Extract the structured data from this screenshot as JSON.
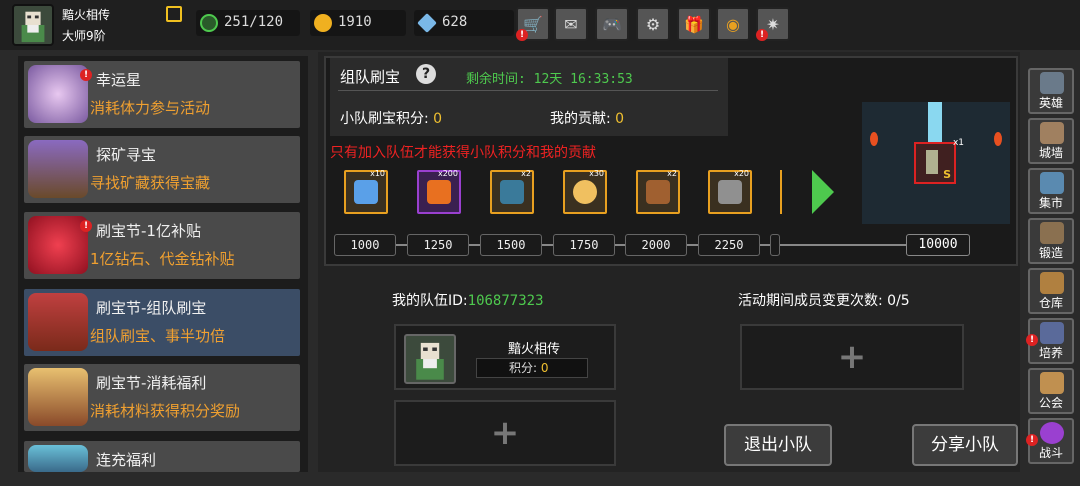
{
  "player": {
    "name": "黯火相传",
    "rank": "大师9阶"
  },
  "resources": [
    {
      "icon": "energy-icon",
      "value": "251/120",
      "color": "#4ec94e"
    },
    {
      "icon": "gold-coin-icon",
      "value": "1910",
      "color": "#f0b020"
    },
    {
      "icon": "diamond-icon",
      "value": "628",
      "color": "#7ab8e8"
    }
  ],
  "toolbar": [
    {
      "icon": "shop-cart-icon",
      "glyph": "🛒",
      "alert": true
    },
    {
      "icon": "mail-icon",
      "glyph": "✉",
      "alert": false
    },
    {
      "icon": "gamepad-icon",
      "glyph": "🎮",
      "alert": false
    },
    {
      "icon": "gear-icon",
      "glyph": "⚙",
      "alert": false
    },
    {
      "icon": "gift-icon",
      "glyph": "🎁",
      "alert": false
    },
    {
      "icon": "color-wheel-icon",
      "glyph": "◉",
      "alert": false
    },
    {
      "icon": "fireworks-icon",
      "glyph": "✷",
      "alert": true
    }
  ],
  "events": [
    {
      "title": "幸运星",
      "subtitle": "消耗体力参与活动",
      "icon": "lucky-star-icon",
      "alert": true,
      "selected": false
    },
    {
      "title": "探矿寻宝",
      "subtitle": "寻找矿藏获得宝藏",
      "icon": "mining-cart-icon",
      "alert": false,
      "selected": false
    },
    {
      "title": "刷宝节-1亿补贴",
      "subtitle": "1亿钻石、代金钻补贴",
      "icon": "red-flower-icon",
      "alert": true,
      "selected": false
    },
    {
      "title": "刷宝节-组队刷宝",
      "subtitle": "组队刷宝、事半功倍",
      "icon": "treasure-chest-icon",
      "alert": false,
      "selected": true
    },
    {
      "title": "刷宝节-消耗福利",
      "subtitle": "消耗材料获得积分奖励",
      "icon": "open-chest-icon",
      "alert": false,
      "selected": false
    },
    {
      "title": "连充福利",
      "subtitle": "",
      "icon": "crystal-icon",
      "alert": false,
      "selected": false
    }
  ],
  "panel": {
    "title": "组队刷宝",
    "timer_label": "剩余时间:",
    "timer_value": "12天 16:33:53",
    "team_score_label": "小队刷宝积分:",
    "team_score": "0",
    "contrib_label": "我的贡献:",
    "contrib": "0",
    "warning": "只有加入队伍才能获得小队积分和我的贡献"
  },
  "rewards": [
    {
      "icon": "lightning-icon",
      "count": "x10",
      "color": "#5aa0e8",
      "purple": false
    },
    {
      "icon": "flame-orb-icon",
      "count": "x200",
      "color": "#e87020",
      "purple": true
    },
    {
      "icon": "book-icon",
      "count": "x2",
      "color": "#3a7a9a",
      "purple": false
    },
    {
      "icon": "egg-icon",
      "count": "x30",
      "color": "#f0c060",
      "purple": false
    },
    {
      "icon": "scroll-icon",
      "count": "x2",
      "color": "#a06030",
      "purple": false
    },
    {
      "icon": "mace-icon",
      "count": "x20",
      "color": "#909090",
      "purple": false
    }
  ],
  "milestones": [
    "1000",
    "1250",
    "1500",
    "1750",
    "2000",
    "2250"
  ],
  "milestone_final": "10000",
  "big_reward": {
    "count": "x1",
    "grade": "S"
  },
  "team": {
    "id_label": "我的队伍ID:",
    "id": "106877323",
    "changes_label": "活动期间成员变更次数:",
    "changes": "0/5",
    "member_name": "黯火相传",
    "member_score_label": "积分:",
    "member_score": "0",
    "add_symbol": "+"
  },
  "buttons": {
    "leave": "退出小队",
    "share": "分享小队"
  },
  "sidenav": [
    {
      "label": "英雄",
      "icon": "hero-helmet-icon",
      "alert": false
    },
    {
      "label": "城墙",
      "icon": "city-wall-icon",
      "alert": false
    },
    {
      "label": "集市",
      "icon": "market-icon",
      "alert": false
    },
    {
      "label": "锻造",
      "icon": "anvil-icon",
      "alert": false
    },
    {
      "label": "仓库",
      "icon": "warehouse-icon",
      "alert": false
    },
    {
      "label": "培养",
      "icon": "training-icon",
      "alert": true
    },
    {
      "label": "公会",
      "icon": "guild-icon",
      "alert": false
    },
    {
      "label": "战斗",
      "icon": "battle-portal-icon",
      "alert": true
    }
  ]
}
